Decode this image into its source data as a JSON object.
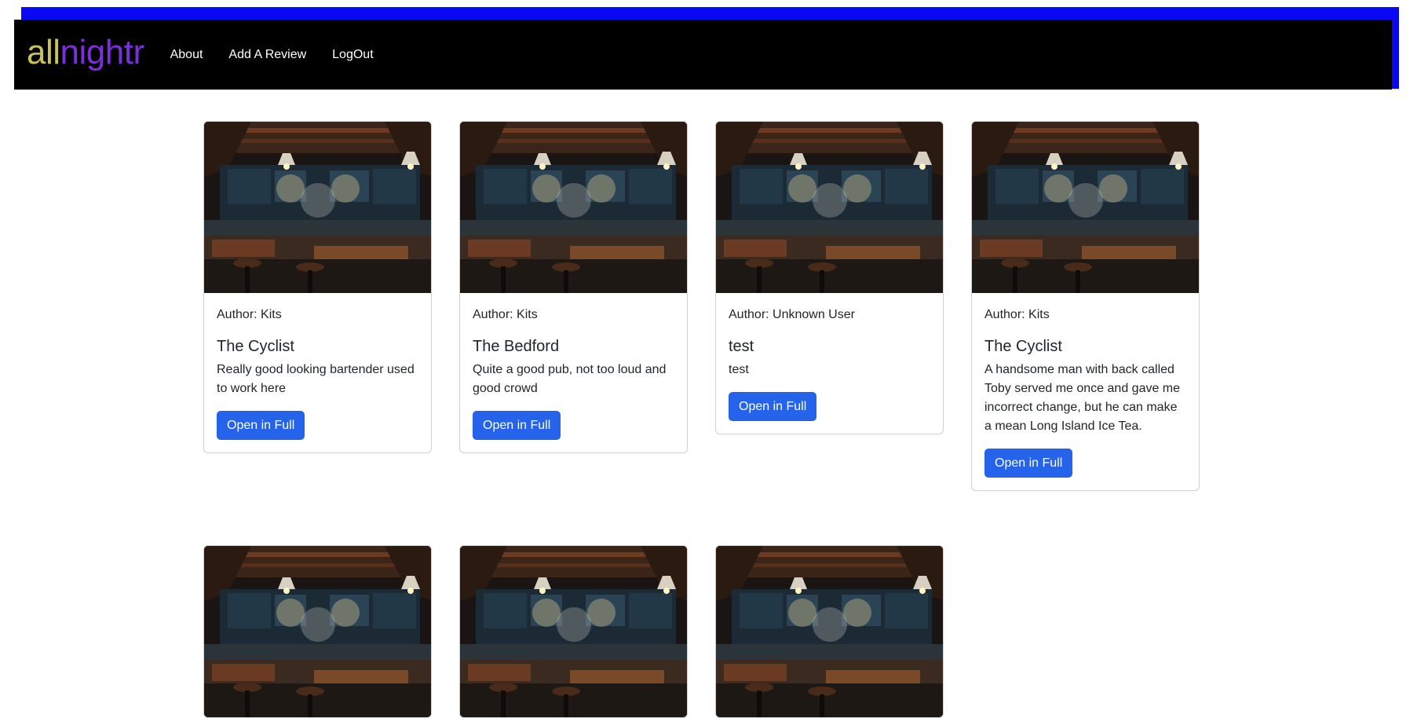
{
  "brand": {
    "part1": "all",
    "part2": "nightr",
    "color1": "#c9c25a",
    "color2": "#7b2fd6"
  },
  "nav": {
    "items": [
      {
        "label": "About"
      },
      {
        "label": "Add A Review"
      },
      {
        "label": "LogOut"
      }
    ]
  },
  "colors": {
    "frame": "#0a07f5",
    "navbar": "#000000",
    "button": "#2563eb"
  },
  "cards": [
    {
      "author": "Author: Kits",
      "title": "The Cyclist",
      "text": "Really good looking bartender used to work here",
      "button": "Open in Full",
      "image": "bar-interior-photo"
    },
    {
      "author": "Author: Kits",
      "title": "The Bedford",
      "text": "Quite a good pub, not too loud and good crowd",
      "button": "Open in Full",
      "image": "bar-interior-photo"
    },
    {
      "author": "Author: Unknown User",
      "title": "test",
      "text": "test",
      "button": "Open in Full",
      "image": "bar-interior-photo"
    },
    {
      "author": "Author: Kits",
      "title": "The Cyclist",
      "text": "A handsome man with back called Toby served me once and gave me incorrect change, but he can make a mean Long Island Ice Tea.",
      "button": "Open in Full",
      "image": "bar-interior-photo"
    },
    {
      "author": "",
      "title": "",
      "text": "",
      "button": "",
      "image": "bar-interior-photo"
    },
    {
      "author": "",
      "title": "",
      "text": "",
      "button": "",
      "image": "bar-interior-photo"
    },
    {
      "author": "",
      "title": "",
      "text": "",
      "button": "",
      "image": "bar-interior-photo"
    }
  ]
}
